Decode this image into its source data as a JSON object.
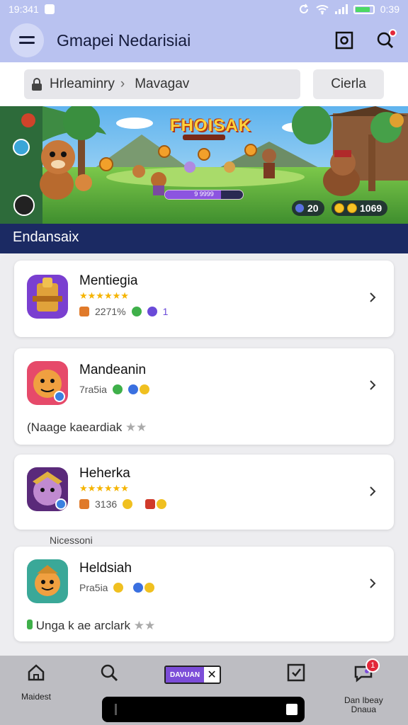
{
  "status_bar": {
    "time": "19:341",
    "battery_time": "0:39"
  },
  "app_bar": {
    "title": "Gmapei Nedarisiai"
  },
  "search": {
    "crumb_1": "Hrleaminry",
    "crumb_sep": "›",
    "crumb_2": "Mavagav",
    "button_label": "Cierla"
  },
  "banner": {
    "title": "FHOISAK",
    "progress_fraction": 0.72,
    "progress_label": "9 9999",
    "counter_left": "20",
    "counter_right": "1069"
  },
  "section": {
    "title": "Endansaix",
    "sub_label": "Nicessoni"
  },
  "apps": [
    {
      "name": "Mentiegia",
      "stars": "★★★★★★",
      "meta_1": "2271%",
      "meta_3": "1",
      "chevron": "›"
    },
    {
      "name": "Mandeanin",
      "meta_1": "7ra5ia",
      "description": "(Naage kaeardiak",
      "desc_dim": "★★",
      "chevron": "›"
    },
    {
      "name": "Heherka",
      "stars": "★★★★★★",
      "meta_1": "3136",
      "chevron": "›"
    },
    {
      "name": "Heldsiah",
      "meta_1": "Pra5ia",
      "description": "Unga k ae arclark",
      "desc_dim": "★★",
      "chevron": "›"
    }
  ],
  "nav": {
    "home_label": "Maidest",
    "center_pill": "DAVUAN",
    "notif_count": "1",
    "profile_label_1": "Dan Ibeay",
    "profile_label_2": "Dnaua"
  },
  "colors": {
    "app_bar": "#b9c2f0",
    "section_header": "#1b2a63",
    "accent_purple": "#7c4dd8",
    "star": "#f5b400"
  }
}
